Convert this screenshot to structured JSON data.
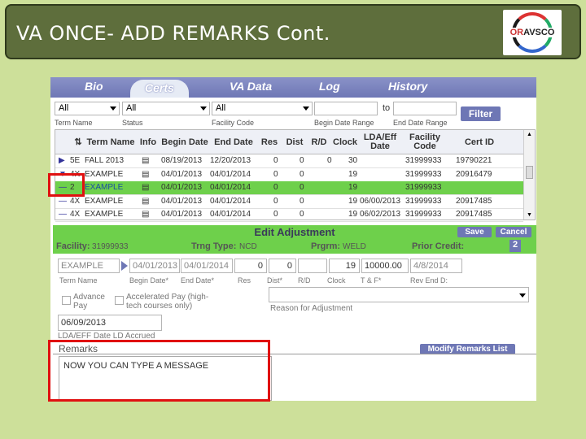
{
  "slide": {
    "title": "VA ONCE- ADD REMARKS Cont."
  },
  "logo": {
    "prefix": "OR",
    "name": "AVSCO"
  },
  "tabs": [
    "Bio",
    "Certs",
    "VA Data",
    "Log",
    "History"
  ],
  "filters": {
    "term": "All",
    "status": "All",
    "facility": "All",
    "to_label": "to",
    "filter_button": "Filter",
    "labels": [
      "Term Name",
      "Status",
      "Facility Code",
      "Begin Date Range",
      "End Date Range"
    ]
  },
  "grid": {
    "headers": [
      "Term Name",
      "Info",
      "Begin Date",
      "End Date",
      "Res",
      "Dist",
      "R/D",
      "Clock",
      "LDA/Eff Date",
      "Facility Code",
      "Cert ID"
    ],
    "rows": [
      {
        "mark": "▶",
        "code": "5E",
        "term": "FALL 2013",
        "begin": "08/19/2013",
        "end": "12/20/2013",
        "res": "0",
        "dist": "0",
        "rd": "0",
        "clock": "30",
        "lda": "",
        "facility": "31999933",
        "cert": "19790221"
      },
      {
        "mark": "▼",
        "code": "4X",
        "term": "EXAMPLE",
        "begin": "04/01/2013",
        "end": "04/01/2014",
        "res": "0",
        "dist": "0",
        "rd": "",
        "clock": "19",
        "lda": "",
        "facility": "31999933",
        "cert": "20916479"
      },
      {
        "mark": "—",
        "code": "2",
        "term": "EXAMPLE",
        "begin": "04/01/2013",
        "end": "04/01/2014",
        "res": "0",
        "dist": "0",
        "rd": "",
        "clock": "19",
        "lda": "",
        "facility": "31999933",
        "cert": ""
      },
      {
        "mark": "—",
        "code": "4X",
        "term": "EXAMPLE",
        "begin": "04/01/2013",
        "end": "04/01/2014",
        "res": "0",
        "dist": "0",
        "rd": "",
        "clock": "19",
        "lda": "06/00/2013",
        "facility": "31999933",
        "cert": "20917485"
      },
      {
        "mark": "—",
        "code": "4X",
        "term": "EXAMPLE",
        "begin": "04/01/2013",
        "end": "04/01/2014",
        "res": "0",
        "dist": "0",
        "rd": "",
        "clock": "19",
        "lda": "06/02/2013",
        "facility": "31999933",
        "cert": "20917485"
      }
    ]
  },
  "edit": {
    "title": "Edit Adjustment",
    "save": "Save",
    "cancel": "Cancel",
    "facility_label": "Facility:",
    "facility_value": "31999933",
    "trng_label": "Trng Type:",
    "trng_value": "NCD",
    "prgrm_label": "Prgrm:",
    "prgrm_value": "WELD",
    "prior_label": "Prior Credit:",
    "prior_value": "2",
    "term_value": "EXAMPLE",
    "begin_value": "04/01/2013",
    "end_value": "04/01/2014",
    "res_value": "0",
    "dist_value": "0",
    "rd_value": "",
    "clock_value": "19",
    "tf_value": "10000.00",
    "rev_value": "4/8/2014",
    "field_labels": [
      "Term Name",
      "Begin Date*",
      "End Date*",
      "Res",
      "Dist*",
      "R/D",
      "Clock",
      "T & F*",
      "Rev End D:"
    ],
    "advance_pay": "Advance Pay",
    "accelerated_pay": "Accelerated Pay (high-tech courses only)",
    "reason_label": "Reason for Adjustment",
    "lda_value": "06/09/2013",
    "lda_label": "LDA/EFF Date LD Accrued",
    "remarks_label": "Remarks",
    "modify_remarks": "Modify Remarks List",
    "remarks_text": "NOW YOU CAN TYPE A MESSAGE"
  }
}
